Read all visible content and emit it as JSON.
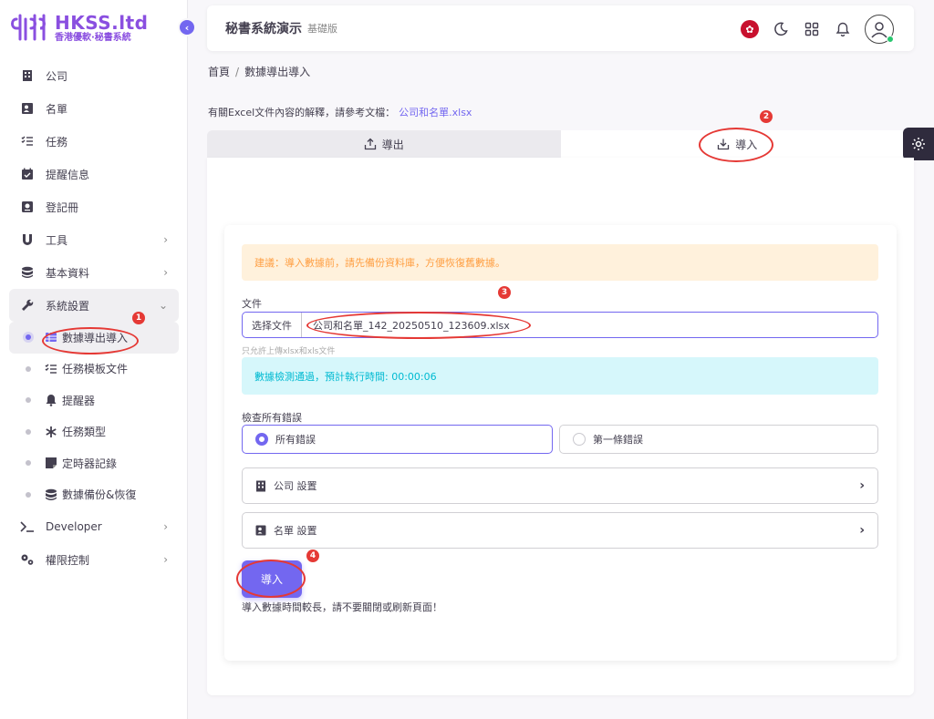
{
  "brand": {
    "name": "HKSS.ltd",
    "tagline": "香港優軟·秘書系統"
  },
  "sidebar": {
    "items": [
      {
        "label": "公司"
      },
      {
        "label": "名單"
      },
      {
        "label": "任務"
      },
      {
        "label": "提醒信息"
      },
      {
        "label": "登記冊"
      },
      {
        "label": "工具"
      },
      {
        "label": "基本資料"
      },
      {
        "label": "系統設置"
      }
    ],
    "sub_items": [
      {
        "label": "數據導出導入"
      },
      {
        "label": "任務模板文件"
      },
      {
        "label": "提醒器"
      },
      {
        "label": "任務類型"
      },
      {
        "label": "定時器記錄"
      },
      {
        "label": "數據備份&恢復"
      }
    ],
    "bottom_items": [
      {
        "label": "Developer"
      },
      {
        "label": "權限控制"
      }
    ]
  },
  "header": {
    "title": "秘書系統演示",
    "edition": "基礎版"
  },
  "breadcrumb": {
    "home": "首頁",
    "sep": "/",
    "current": "數據導出導入"
  },
  "info": {
    "text": "有關Excel文件內容的解釋，請參考文檔：",
    "link": "公司和名單.xlsx"
  },
  "tabs": {
    "export": "導出",
    "import": "導入"
  },
  "form": {
    "warning": "建議：導入數據前，請先備份資料庫，方便恢復舊數據。",
    "file_label": "文件",
    "file_button": "选择文件",
    "file_name": "公司和名單_142_20250510_123609.xlsx",
    "file_help": "只允許上傳xlsx和xls文件",
    "check_result": "數據檢測通過，預計執行時間: 00:00:06",
    "check_label": "檢查所有錯誤",
    "radio_all": "所有錯誤",
    "radio_first": "第一條錯誤",
    "acc_company": "公司 設置",
    "acc_list": "名單 設置",
    "import_button": "導入",
    "import_note": "導入數據時間較長，請不要關閉或刷新頁面！"
  },
  "annotations": {
    "b1": "1",
    "b2": "2",
    "b3": "3",
    "b4": "4"
  },
  "colors": {
    "primary": "#7367f0",
    "warning": "#ff9f43",
    "info": "#00bad1",
    "annotation": "#e53935"
  }
}
